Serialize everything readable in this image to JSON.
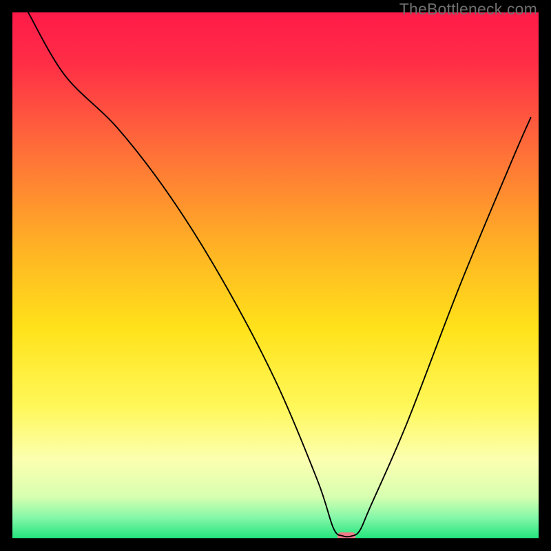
{
  "watermark": "TheBottleneck.com",
  "chart_data": {
    "type": "line",
    "title": "",
    "xlabel": "",
    "ylabel": "",
    "xlim": [
      0,
      100
    ],
    "ylim": [
      0,
      100
    ],
    "gradient_stops": [
      {
        "offset": 0.0,
        "color": "#ff1a49"
      },
      {
        "offset": 0.1,
        "color": "#ff2f46"
      },
      {
        "offset": 0.25,
        "color": "#ff6a3a"
      },
      {
        "offset": 0.45,
        "color": "#ffb324"
      },
      {
        "offset": 0.6,
        "color": "#ffe21a"
      },
      {
        "offset": 0.75,
        "color": "#fff85a"
      },
      {
        "offset": 0.85,
        "color": "#fcffb0"
      },
      {
        "offset": 0.92,
        "color": "#d8ffb0"
      },
      {
        "offset": 0.96,
        "color": "#85f7a8"
      },
      {
        "offset": 1.0,
        "color": "#22e47c"
      }
    ],
    "series": [
      {
        "name": "bottleneck-curve",
        "x": [
          3,
          10,
          20,
          30,
          40,
          50,
          58,
          61,
          62.8,
          64.5,
          66,
          68,
          75,
          85,
          95,
          98.5
        ],
        "values": [
          100,
          88,
          78,
          65,
          49,
          30,
          11,
          2,
          0.5,
          0.5,
          1.5,
          6,
          22,
          48,
          72,
          80
        ]
      }
    ],
    "marker": {
      "x": 63.5,
      "y": 0.5,
      "width_pct": 3.5,
      "height_pct": 1.4,
      "color": "#ef7b89"
    }
  }
}
